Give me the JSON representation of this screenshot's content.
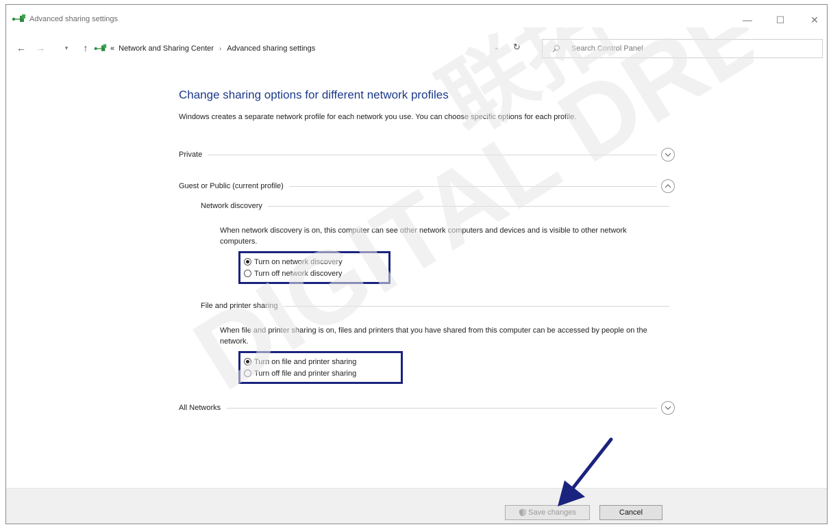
{
  "window": {
    "title": "Advanced sharing settings",
    "controls": {
      "minimize": "—",
      "maximize": "☐",
      "close": "✕"
    }
  },
  "navigation": {
    "back": "←",
    "forward": "→",
    "recent": "▾",
    "up": "↑",
    "overflow": "«",
    "breadcrumb": [
      "Network and Sharing Center",
      "Advanced sharing settings"
    ],
    "separator": "›",
    "address_dropdown": "⌄",
    "refresh": "↻",
    "search_placeholder": "Search Control Panel"
  },
  "main": {
    "heading": "Change sharing options for different network profiles",
    "intro": "Windows creates a separate network profile for each network you use. You can choose specific options for each profile.",
    "profiles": {
      "private": {
        "label": "Private",
        "expanded": false
      },
      "guest_public": {
        "label": "Guest or Public (current profile)",
        "expanded": true
      },
      "all_networks": {
        "label": "All Networks",
        "expanded": false
      }
    },
    "network_discovery": {
      "label": "Network discovery",
      "description": "When network discovery is on, this computer can see other network computers and devices and is visible to other network computers.",
      "options": [
        {
          "label": "Turn on network discovery",
          "selected": true
        },
        {
          "label": "Turn off network discovery",
          "selected": false
        }
      ]
    },
    "file_printer_sharing": {
      "label": "File and printer sharing",
      "description": "When file and printer sharing is on, files and printers that you have shared from this computer can be accessed by people on the network.",
      "options": [
        {
          "label": "Turn on file and printer sharing",
          "selected": true
        },
        {
          "label": "Turn off file and printer sharing",
          "selected": false
        }
      ]
    }
  },
  "footer": {
    "save_label": "Save changes",
    "save_enabled": false,
    "cancel_label": "Cancel"
  },
  "overlays": {
    "watermark_text": "DIGITAL DREAM",
    "watermark_cjk": "联拓",
    "highlight_color": "#1a237e",
    "arrow_color": "#1a237e"
  },
  "colors": {
    "heading": "#1c3a8a",
    "network_icon": "#2e8b3d"
  }
}
